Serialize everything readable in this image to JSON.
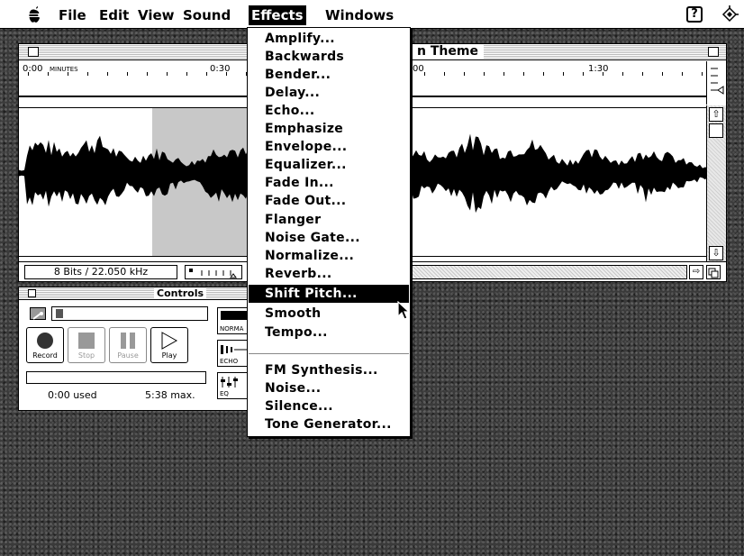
{
  "menubar": {
    "apple_icon": "apple-icon",
    "items": [
      "File",
      "Edit",
      "View",
      "Sound",
      "Effects",
      "Windows"
    ],
    "active": "Effects",
    "help_icon": "?",
    "app_icon": "app-icon"
  },
  "sound_window": {
    "title": "n Theme",
    "timeline_labels": {
      "start": "0:00",
      "minutes": "MINUTES",
      "t30": "0:30",
      "t60": "00",
      "t90": "1:30"
    },
    "format": "8 Bits / 22.050 kHz"
  },
  "controls": {
    "title": "Controls",
    "buttons": {
      "record": "Record",
      "stop": "Stop",
      "pause": "Pause",
      "play": "Play"
    },
    "effect_buttons": [
      "NORMA",
      "ECHO",
      "EQ"
    ],
    "used": "0:00 used",
    "max": "5:38 max."
  },
  "effects_menu": {
    "items": [
      "Amplify...",
      "Backwards",
      "Bender...",
      "Delay...",
      "Echo...",
      "Emphasize",
      "Envelope...",
      "Equalizer...",
      "Fade In...",
      "Fade Out...",
      "Flanger",
      "Noise Gate...",
      "Normalize...",
      "Reverb...",
      "Shift Pitch...",
      "Smooth",
      "Tempo..."
    ],
    "items2": [
      "FM Synthesis...",
      "Noise...",
      "Silence...",
      "Tone Generator..."
    ],
    "highlighted": "Shift Pitch..."
  },
  "colors": {
    "desktop": "#3a3a3a",
    "selection": "#c8c8c8",
    "highlight": "#000000"
  }
}
